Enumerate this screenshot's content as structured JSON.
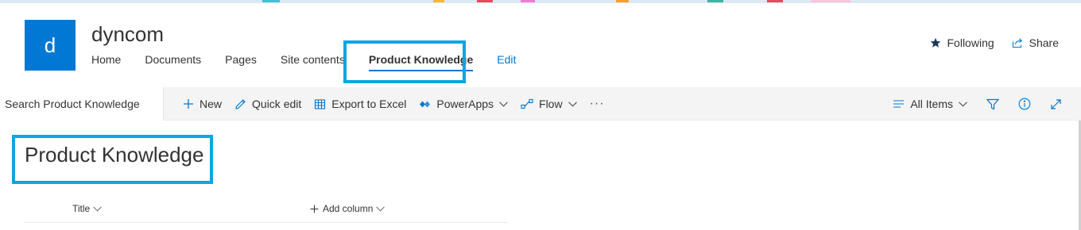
{
  "site": {
    "logo_letter": "d",
    "title": "dyncom",
    "nav": [
      {
        "label": "Home"
      },
      {
        "label": "Documents"
      },
      {
        "label": "Pages"
      },
      {
        "label": "Site contents"
      },
      {
        "label": "Product Knowledge",
        "selected": true
      },
      {
        "label": "Edit"
      }
    ],
    "actions": {
      "following_label": "Following",
      "share_label": "Share"
    }
  },
  "command_bar": {
    "search_placeholder": "Search Product Knowledge",
    "new_label": "New",
    "quick_edit_label": "Quick edit",
    "export_label": "Export to Excel",
    "powerapps_label": "PowerApps",
    "flow_label": "Flow",
    "more_label": "···",
    "view_label": "All Items",
    "icons": [
      "plus-icon",
      "pencil-icon",
      "excel-icon",
      "powerapps-icon",
      "flow-icon",
      "filter-icon",
      "info-icon",
      "expand-icon"
    ]
  },
  "list": {
    "title": "Product Knowledge",
    "columns": {
      "title_label": "Title",
      "add_column_label": "Add column"
    }
  },
  "colors": {
    "accent": "#0078d4",
    "highlight_border": "#0ea5e0",
    "command_bar_bg": "#f4f4f4"
  }
}
